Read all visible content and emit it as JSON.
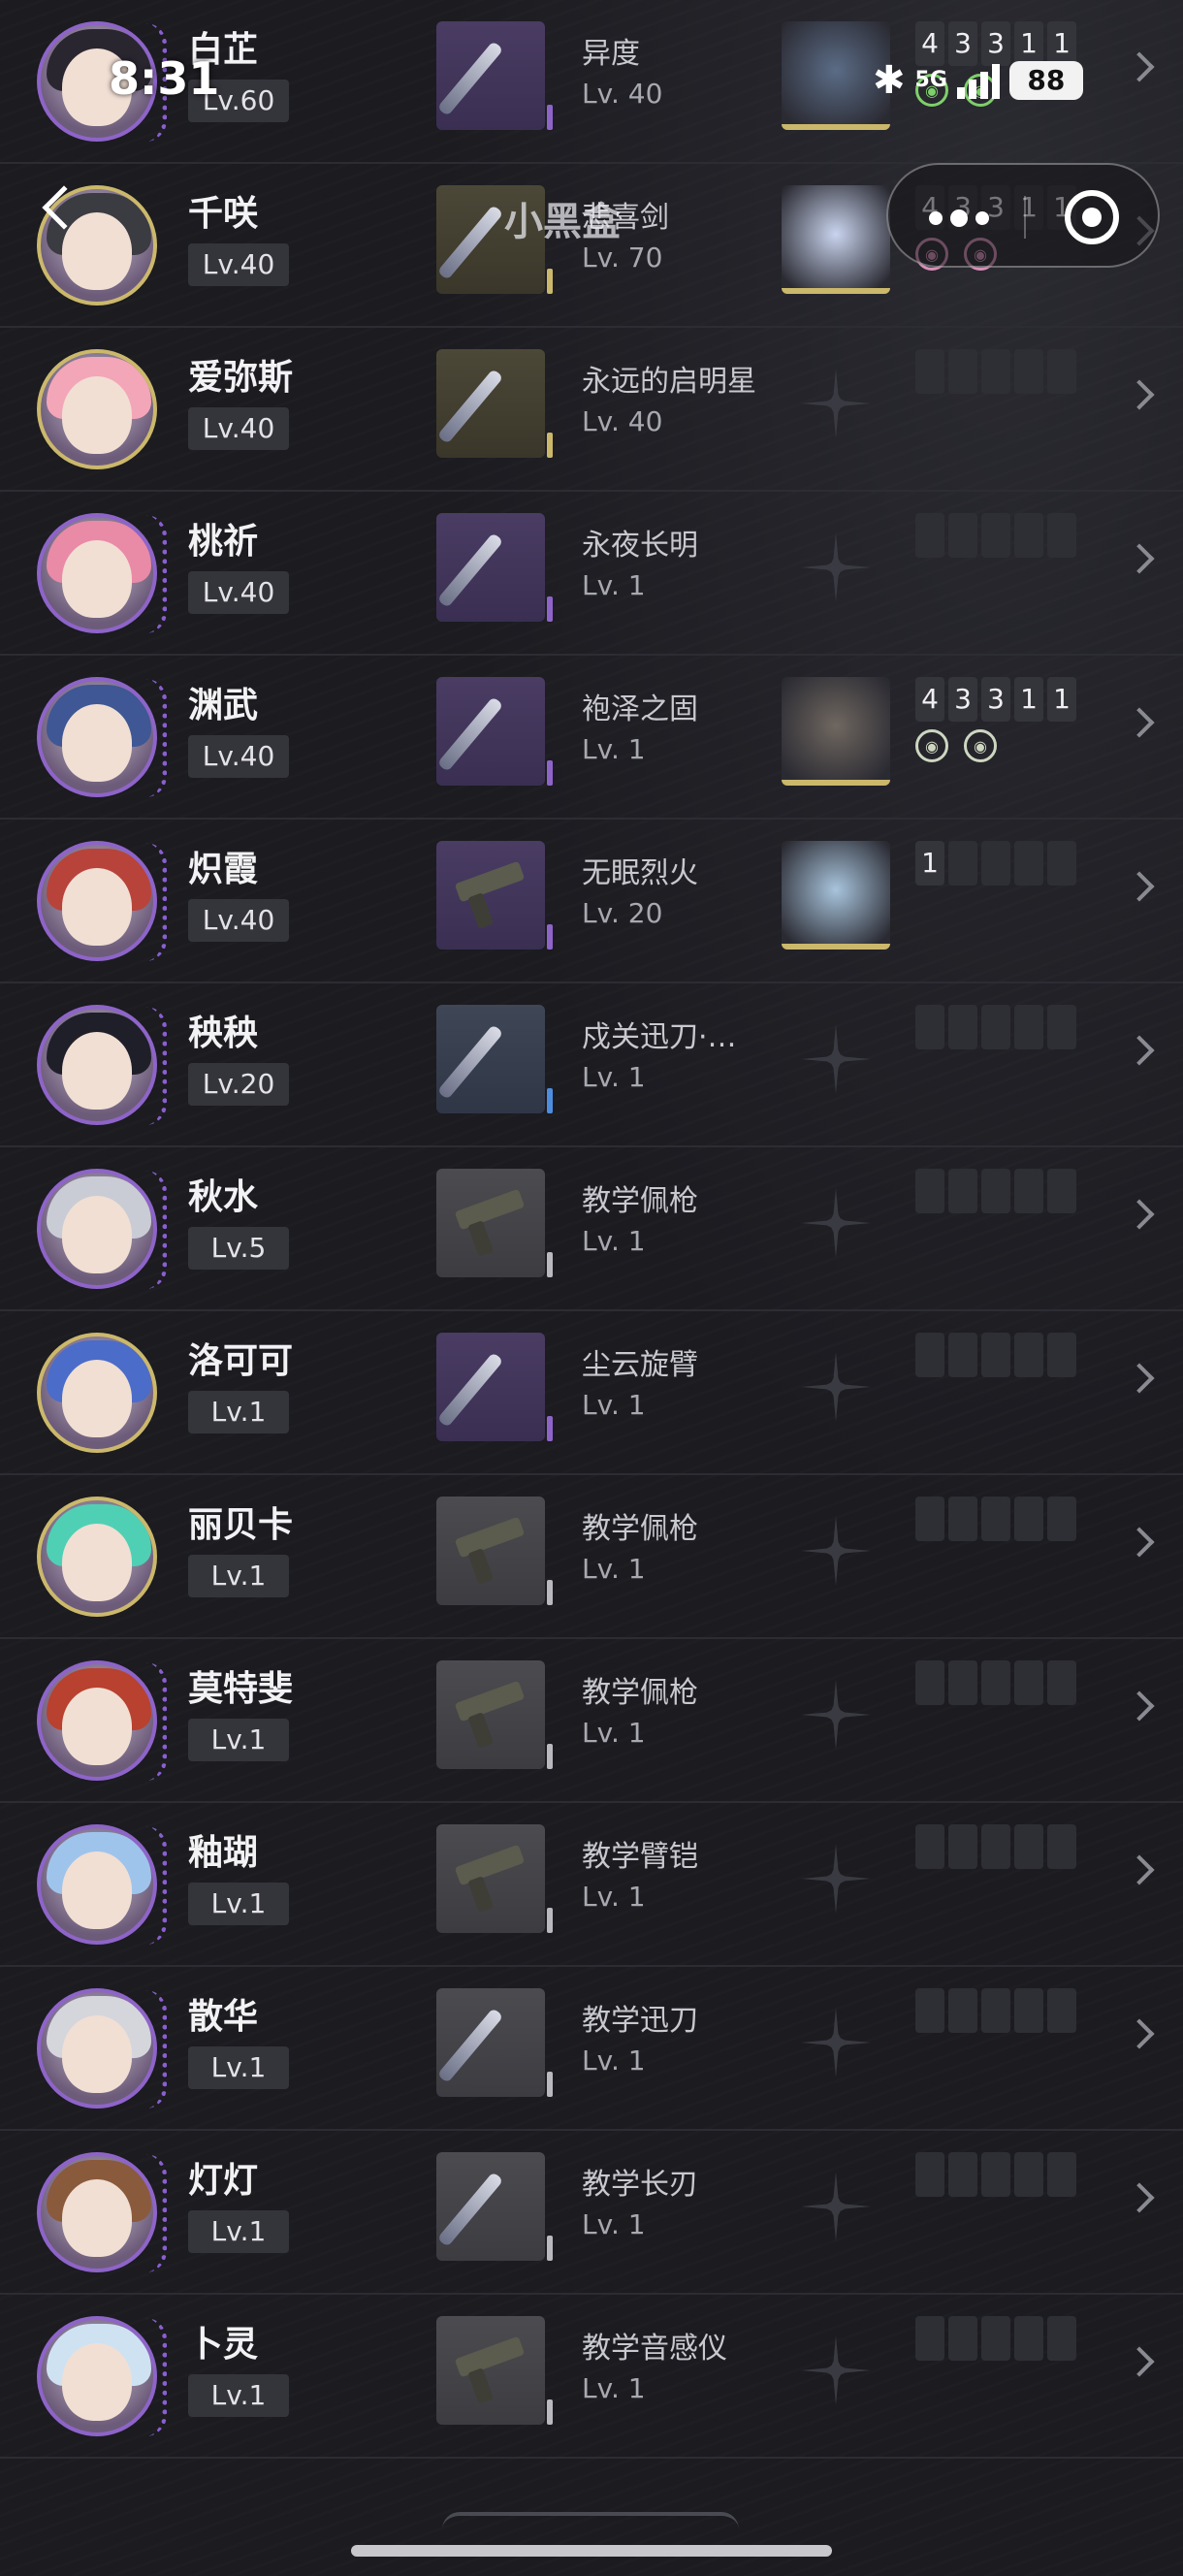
{
  "status_bar": {
    "time": "8:31",
    "network": "5G",
    "battery": "88"
  },
  "watermark": "小黑盒",
  "characters": [
    {
      "name": "白芷",
      "level": "Lv.60",
      "avatar_frame": "purple",
      "hair": "#2a2630",
      "weapon": {
        "name": "异度",
        "level": "Lv. 40",
        "rarity": "purple",
        "kind": "blade"
      },
      "echo": {
        "present": true,
        "color": "#5b6c86",
        "slots": [
          "4",
          "3",
          "3",
          "1",
          "1"
        ],
        "sets": [
          "green",
          "green"
        ]
      }
    },
    {
      "name": "千咲",
      "level": "Lv.40",
      "avatar_frame": "gold",
      "hair": "#3b3b42",
      "weapon": {
        "name": "悲喜剑",
        "level": "Lv. 70",
        "rarity": "gold",
        "kind": "blade"
      },
      "echo": {
        "present": true,
        "color": "#c9d4ee",
        "slots": [
          "4",
          "3",
          "3",
          "1",
          "1"
        ],
        "sets": [
          "pink",
          "pink"
        ]
      }
    },
    {
      "name": "爱弥斯",
      "level": "Lv.40",
      "avatar_frame": "gold",
      "hair": "#f3a6b8",
      "weapon": {
        "name": "永远的启明星",
        "level": "Lv. 40",
        "rarity": "gold",
        "kind": "blade"
      },
      "echo": {
        "present": false,
        "slots": [
          "",
          "",
          "",
          "",
          ""
        ],
        "sets": []
      }
    },
    {
      "name": "桃祈",
      "level": "Lv.40",
      "avatar_frame": "purple",
      "hair": "#e98aa7",
      "weapon": {
        "name": "永夜长明",
        "level": "Lv. 1",
        "rarity": "purple",
        "kind": "blade"
      },
      "echo": {
        "present": false,
        "slots": [
          "",
          "",
          "",
          "",
          ""
        ],
        "sets": []
      }
    },
    {
      "name": "渊武",
      "level": "Lv.40",
      "avatar_frame": "purple",
      "hair": "#3f5794",
      "weapon": {
        "name": "袍泽之固",
        "level": "Lv. 1",
        "rarity": "purple",
        "kind": "blade"
      },
      "echo": {
        "present": true,
        "color": "#6f6760",
        "slots": [
          "4",
          "3",
          "3",
          "1",
          "1"
        ],
        "sets": [
          "white",
          "white"
        ]
      }
    },
    {
      "name": "炽霞",
      "level": "Lv.40",
      "avatar_frame": "purple",
      "hair": "#b8433a",
      "weapon": {
        "name": "无眠烈火",
        "level": "Lv. 20",
        "rarity": "purple",
        "kind": "gun"
      },
      "echo": {
        "present": true,
        "color": "#a8c4dc",
        "slots": [
          "1",
          "",
          "",
          "",
          ""
        ],
        "sets": []
      }
    },
    {
      "name": "秧秧",
      "level": "Lv.20",
      "avatar_frame": "purple",
      "hair": "#1f1f2a",
      "weapon": {
        "name": "戍关迅刀·…",
        "level": "Lv. 1",
        "rarity": "blue",
        "kind": "blade"
      },
      "echo": {
        "present": false,
        "slots": [
          "",
          "",
          "",
          "",
          ""
        ],
        "sets": []
      }
    },
    {
      "name": "秋水",
      "level": "Lv.5",
      "avatar_frame": "purple",
      "hair": "#c9ccd4",
      "weapon": {
        "name": "教学佩枪",
        "level": "Lv. 1",
        "rarity": "grey",
        "kind": "gun"
      },
      "echo": {
        "present": false,
        "slots": [
          "",
          "",
          "",
          "",
          ""
        ],
        "sets": []
      }
    },
    {
      "name": "洛可可",
      "level": "Lv.1",
      "avatar_frame": "gold",
      "hair": "#4b6cc9",
      "weapon": {
        "name": "尘云旋臂",
        "level": "Lv. 1",
        "rarity": "purple",
        "kind": "blade"
      },
      "echo": {
        "present": false,
        "slots": [
          "",
          "",
          "",
          "",
          ""
        ],
        "sets": []
      }
    },
    {
      "name": "丽贝卡",
      "level": "Lv.1",
      "avatar_frame": "gold",
      "hair": "#4fd0b4",
      "weapon": {
        "name": "教学佩枪",
        "level": "Lv. 1",
        "rarity": "grey",
        "kind": "gun"
      },
      "echo": {
        "present": false,
        "slots": [
          "",
          "",
          "",
          "",
          ""
        ],
        "sets": []
      }
    },
    {
      "name": "莫特斐",
      "level": "Lv.1",
      "avatar_frame": "purple",
      "hair": "#b8412f",
      "weapon": {
        "name": "教学佩枪",
        "level": "Lv. 1",
        "rarity": "grey",
        "kind": "gun"
      },
      "echo": {
        "present": false,
        "slots": [
          "",
          "",
          "",
          "",
          ""
        ],
        "sets": []
      }
    },
    {
      "name": "釉瑚",
      "level": "Lv.1",
      "avatar_frame": "purple",
      "hair": "#9fc4ec",
      "weapon": {
        "name": "教学臂铠",
        "level": "Lv. 1",
        "rarity": "grey",
        "kind": "gun"
      },
      "echo": {
        "present": false,
        "slots": [
          "",
          "",
          "",
          "",
          ""
        ],
        "sets": []
      }
    },
    {
      "name": "散华",
      "level": "Lv.1",
      "avatar_frame": "purple",
      "hair": "#d5d6dc",
      "weapon": {
        "name": "教学迅刀",
        "level": "Lv. 1",
        "rarity": "grey",
        "kind": "blade"
      },
      "echo": {
        "present": false,
        "slots": [
          "",
          "",
          "",
          "",
          ""
        ],
        "sets": []
      }
    },
    {
      "name": "灯灯",
      "level": "Lv.1",
      "avatar_frame": "purple",
      "hair": "#8a5a3c",
      "weapon": {
        "name": "教学长刃",
        "level": "Lv. 1",
        "rarity": "grey",
        "kind": "blade"
      },
      "echo": {
        "present": false,
        "slots": [
          "",
          "",
          "",
          "",
          ""
        ],
        "sets": []
      }
    },
    {
      "name": "卜灵",
      "level": "Lv.1",
      "avatar_frame": "purple",
      "hair": "#cfe2f2",
      "weapon": {
        "name": "教学音感仪",
        "level": "Lv. 1",
        "rarity": "grey",
        "kind": "gun"
      },
      "echo": {
        "present": false,
        "slots": [
          "",
          "",
          "",
          "",
          ""
        ],
        "sets": []
      }
    }
  ],
  "colors": {
    "purple": "#8e64c9",
    "gold": "#cbb86b",
    "blue": "#4d8de0",
    "grey": "#b9b9bf"
  }
}
